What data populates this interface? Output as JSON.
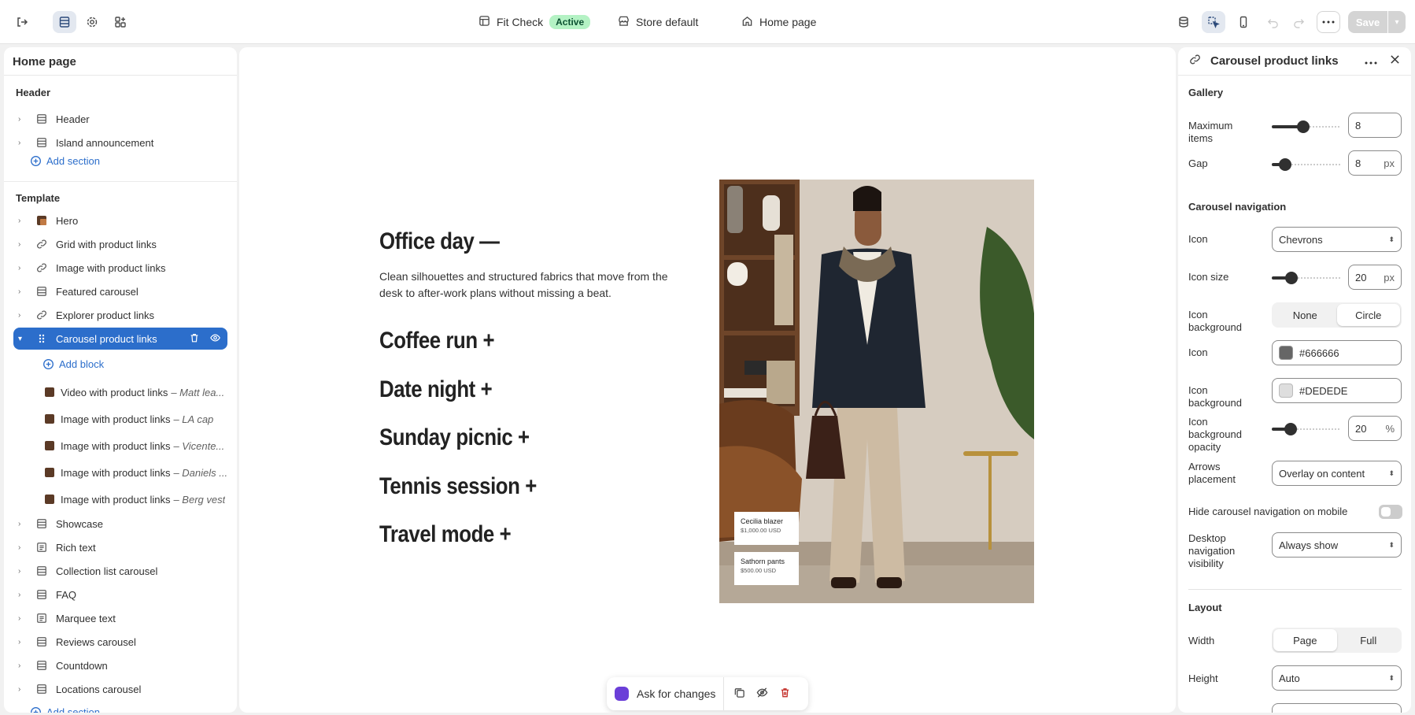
{
  "topbar": {
    "theme_name": "Fit Check",
    "theme_status": "Active",
    "store_label": "Store default",
    "page_label": "Home page",
    "save_label": "Save"
  },
  "left": {
    "title": "Home page",
    "header_group_title": "Header",
    "header_items": [
      {
        "label": "Header",
        "icon": "section-icon"
      },
      {
        "label": "Island announcement",
        "icon": "section-icon"
      }
    ],
    "add_section": "Add section",
    "template_title": "Template",
    "template_items": [
      {
        "label": "Hero",
        "icon": "image-thumb"
      },
      {
        "label": "Grid with product links",
        "icon": "link-icon"
      },
      {
        "label": "Image with product links",
        "icon": "link-icon"
      },
      {
        "label": "Featured carousel",
        "icon": "section-icon"
      },
      {
        "label": "Explorer product links",
        "icon": "link-icon"
      },
      {
        "label": "Carousel product links",
        "icon": "drag-icon"
      }
    ],
    "add_block": "Add block",
    "blocks": [
      {
        "label": "Video with product links",
        "sub": "– Matt lea..."
      },
      {
        "label": "Image with product links",
        "sub": "– LA cap"
      },
      {
        "label": "Image with product links",
        "sub": "– Vicente..."
      },
      {
        "label": "Image with product links",
        "sub": "– Daniels ..."
      },
      {
        "label": "Image with product links",
        "sub": "– Berg vest"
      }
    ],
    "after_items": [
      {
        "label": "Showcase"
      },
      {
        "label": "Rich text"
      },
      {
        "label": "Collection list carousel"
      },
      {
        "label": "FAQ"
      },
      {
        "label": "Marquee text"
      },
      {
        "label": "Reviews carousel"
      },
      {
        "label": "Countdown"
      },
      {
        "label": "Locations carousel"
      }
    ],
    "add_section_bottom": "Add section"
  },
  "canvas": {
    "headings": [
      "Office day —",
      "Coffee run +",
      "Date night +",
      "Sunday picnic +",
      "Tennis session +",
      "Travel mode +"
    ],
    "description": "Clean silhouettes and structured fabrics that move from the desk to after-work plans without missing a beat.",
    "tags": [
      {
        "name": "Cecilia blazer",
        "price": "$1,000.00 USD"
      },
      {
        "name": "Sathorn pants",
        "price": "$500.00 USD"
      }
    ],
    "ask_label": "Ask for changes"
  },
  "right": {
    "title": "Carousel product links",
    "gallery_title": "Gallery",
    "max_items_label": "Maximum items",
    "max_items_value": "8",
    "max_items_fraction": 0.45,
    "gap_label": "Gap",
    "gap_value": "8",
    "gap_fraction": 0.12,
    "unit_px": "px",
    "unit_pct": "%",
    "nav_title": "Carousel navigation",
    "icon_label": "Icon",
    "icon_value": "Chevrons",
    "icon_size_label": "Icon size",
    "icon_size_value": "20",
    "icon_size_fraction": 0.24,
    "icon_bg_label": "Icon background",
    "icon_bg_options": [
      "None",
      "Circle"
    ],
    "icon_color_label": "Icon",
    "icon_color": "#666666",
    "icon_bg_color_label": "Icon background",
    "icon_bg_color": "#DEDEDE",
    "icon_bg_opacity_label": "Icon background opacity",
    "icon_bg_opacity_value": "20",
    "icon_bg_opacity_fraction": 0.22,
    "arrows_label": "Arrows placement",
    "arrows_value": "Overlay on content",
    "hide_mobile_label": "Hide carousel navigation on mobile",
    "desktop_vis_label": "Desktop navigation visibility",
    "desktop_vis_value": "Always show",
    "layout_title": "Layout",
    "width_label": "Width",
    "width_options": [
      "Page",
      "Full"
    ],
    "height_label": "Height",
    "height_value": "Auto"
  },
  "colors": {
    "accent": "#2c6ecb",
    "active_badge": "#b4f2c4"
  }
}
